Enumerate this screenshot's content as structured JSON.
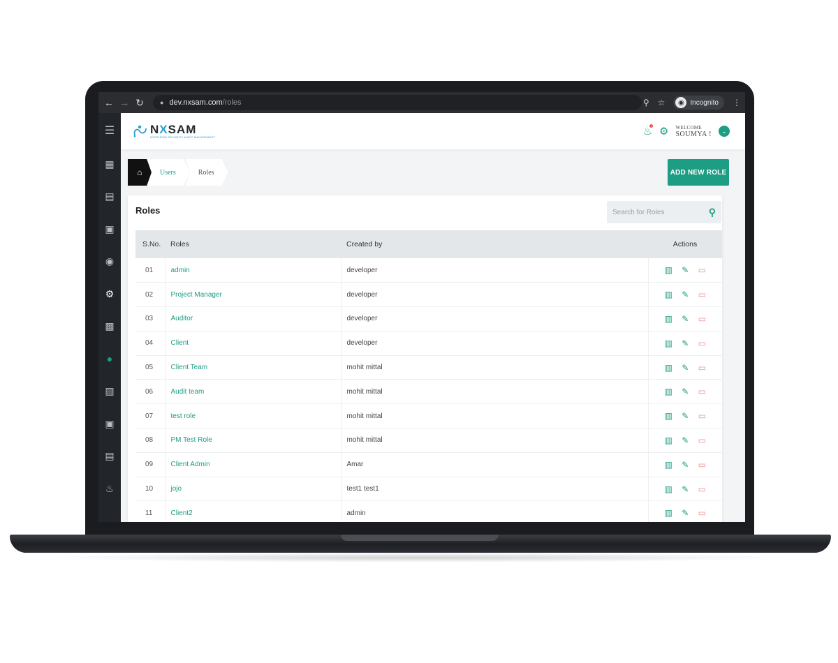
{
  "browser": {
    "url_host": "dev.nxsam.com",
    "url_path": "/roles",
    "incognito_label": "Incognito"
  },
  "header": {
    "logo_name_pre": "N",
    "logo_name_x": "X",
    "logo_name_post": "SAM",
    "logo_tagline": "NORTHERN SECURITY AUDIT MANAGEMENT",
    "welcome_label": "WELCOME",
    "user_name": "SOUMYA !"
  },
  "breadcrumb": {
    "items": [
      {
        "label": "Users"
      },
      {
        "label": "Roles"
      }
    ]
  },
  "toolbar": {
    "add_role_label": "ADD NEW ROLE"
  },
  "card": {
    "title": "Roles",
    "search_placeholder": "Search for Roles"
  },
  "table": {
    "headers": {
      "sno": "S.No.",
      "role": "Roles",
      "created_by": "Created by",
      "actions": "Actions"
    },
    "rows": [
      {
        "sno": "01",
        "role": "admin",
        "created_by": "developer"
      },
      {
        "sno": "02",
        "role": "Project Manager",
        "created_by": "developer"
      },
      {
        "sno": "03",
        "role": "Auditor",
        "created_by": "developer"
      },
      {
        "sno": "04",
        "role": "Client",
        "created_by": "developer"
      },
      {
        "sno": "05",
        "role": "Client Team",
        "created_by": "mohit mittal"
      },
      {
        "sno": "06",
        "role": "Audit team",
        "created_by": "mohit mittal"
      },
      {
        "sno": "07",
        "role": "test role",
        "created_by": "mohit mittal"
      },
      {
        "sno": "08",
        "role": "PM Test Role",
        "created_by": "mohit mittal"
      },
      {
        "sno": "09",
        "role": "Client Admin",
        "created_by": "Amar"
      },
      {
        "sno": "10",
        "role": "jojo",
        "created_by": "test1 test1"
      },
      {
        "sno": "11",
        "role": "Client2",
        "created_by": "admin"
      }
    ]
  },
  "colors": {
    "accent": "#1d9d83",
    "delete": "#f08c8c",
    "sidebar": "#22262b"
  }
}
